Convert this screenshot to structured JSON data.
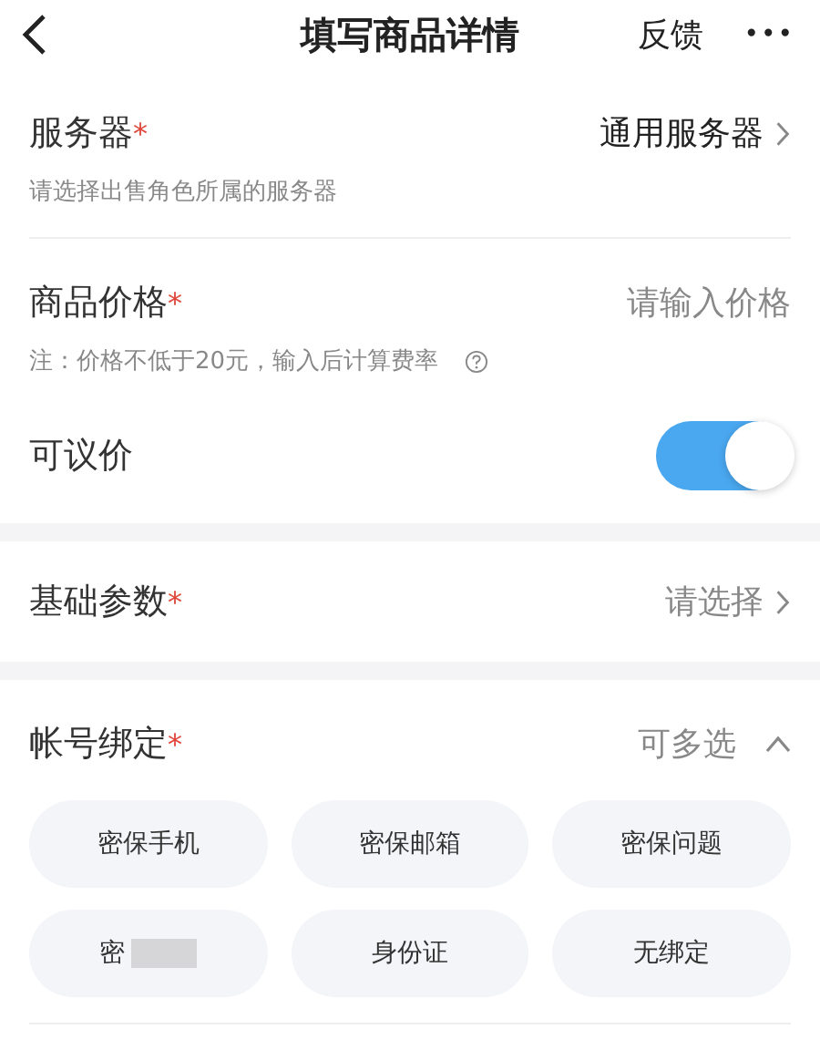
{
  "header": {
    "title": "填写商品详情",
    "feedback": "反馈",
    "more": "•••"
  },
  "server": {
    "label": "服务器",
    "required_mark": "*",
    "value": "通用服务器",
    "hint": "请选择出售角色所属的服务器"
  },
  "price": {
    "label": "商品价格",
    "required_mark": "*",
    "placeholder": "请输入价格",
    "note": "注：价格不低于20元，输入后计算费率"
  },
  "negotiable": {
    "label": "可议价",
    "on": true
  },
  "basic_params": {
    "label": "基础参数",
    "required_mark": "*",
    "placeholder": "请选择"
  },
  "account_binding": {
    "label": "帐号绑定",
    "required_mark": "*",
    "value": "可多选",
    "expanded": true,
    "options": [
      {
        "label": "密保手机",
        "selected": false
      },
      {
        "label": "密保邮箱",
        "selected": false
      },
      {
        "label": "密保问题",
        "selected": false
      },
      {
        "label": "密",
        "selected": false,
        "redacted": true
      },
      {
        "label": "身份证",
        "selected": false
      },
      {
        "label": "无绑定",
        "selected": false
      }
    ]
  }
}
